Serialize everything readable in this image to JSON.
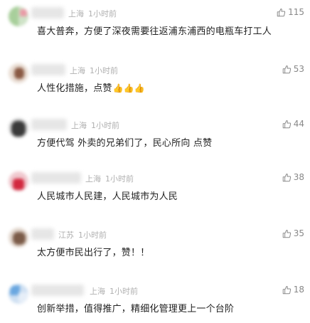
{
  "comments": [
    {
      "location": "上海",
      "time": "1小时前",
      "likes": "115",
      "text": "喜大普奔，方便了深夜需要往返浦东浦西的电瓶车打工人",
      "emoji": ""
    },
    {
      "location": "上海",
      "time": "1小时前",
      "likes": "53",
      "text": "人性化措施，点赞",
      "emoji": "👍👍👍"
    },
    {
      "location": "上海",
      "time": "1小时前",
      "likes": "44",
      "text": "方便代驾 外卖的兄弟们了，民心所向 点赞",
      "emoji": ""
    },
    {
      "location": "上海",
      "time": "1小时前",
      "likes": "38",
      "text": "人民城市人民建，人民城市为人民",
      "emoji": ""
    },
    {
      "location": "江苏",
      "time": "1小时前",
      "likes": "35",
      "text": "太方便市民出行了，赞！！",
      "emoji": ""
    },
    {
      "location": "上海",
      "time": "1小时前",
      "likes": "18",
      "text": "创新举措，值得推广，精细化管理更上一个台阶",
      "emoji": ""
    }
  ],
  "icons": {
    "like": "thumbs-up-outline-icon",
    "emoji": "thumbs-up-emoji-icon"
  },
  "colors": {
    "meta_text": "#b0b0b0",
    "body_text": "#222222",
    "like_count": "#888888"
  }
}
